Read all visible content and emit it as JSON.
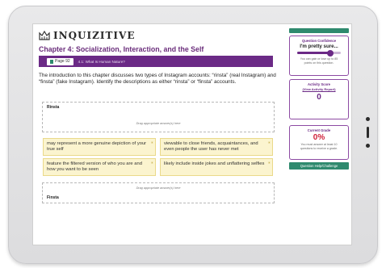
{
  "app": {
    "logo_text": "INQUIZITIVE"
  },
  "header": {
    "chapter_title": "Chapter 4: Socialization, Interaction, and the Self"
  },
  "pagebar": {
    "page_label": "Page 92",
    "section_label": "4.1: What Is Human Nature?"
  },
  "question": {
    "prompt": "The introduction to this chapter discusses two types of Instagram accounts: “rinsta” (real Instagram) and “finsta” (fake Instagram). Identify the descriptions as either “rinsta” or “finsta” accounts."
  },
  "zones": {
    "rinsta": {
      "label": "Rinsta",
      "hint": "Drag appropriate answer(s) here"
    },
    "finsta": {
      "label": "Finsta",
      "hint": "Drag appropriate answer(s) here"
    }
  },
  "answers": [
    "may represent a more genuine depiction of your true self",
    "viewable to close friends, acquaintances, and even people the user has never met",
    "feature the filtered version of who you are and how you want to be seen",
    "likely include inside jokes and unflattering selfies"
  ],
  "confidence": {
    "title": "Question Confidence",
    "value": "I'm pretty sure...",
    "level": 0.75,
    "note": "You can gain or lose up to 85 points on this question."
  },
  "activity": {
    "title": "Activity Score",
    "link": "(View Activity Report)",
    "score": "0"
  },
  "grade": {
    "title": "Current Grade",
    "value": "0%",
    "note": "You must answer at least 10 questions to receive a grade."
  },
  "help": {
    "label": "Question Help/Challenge"
  },
  "colors": {
    "brand_purple": "#6b2a86",
    "accent_green": "#2f8a6e",
    "grade_red": "#d0203a",
    "answer_bg": "#fbf4cf"
  }
}
